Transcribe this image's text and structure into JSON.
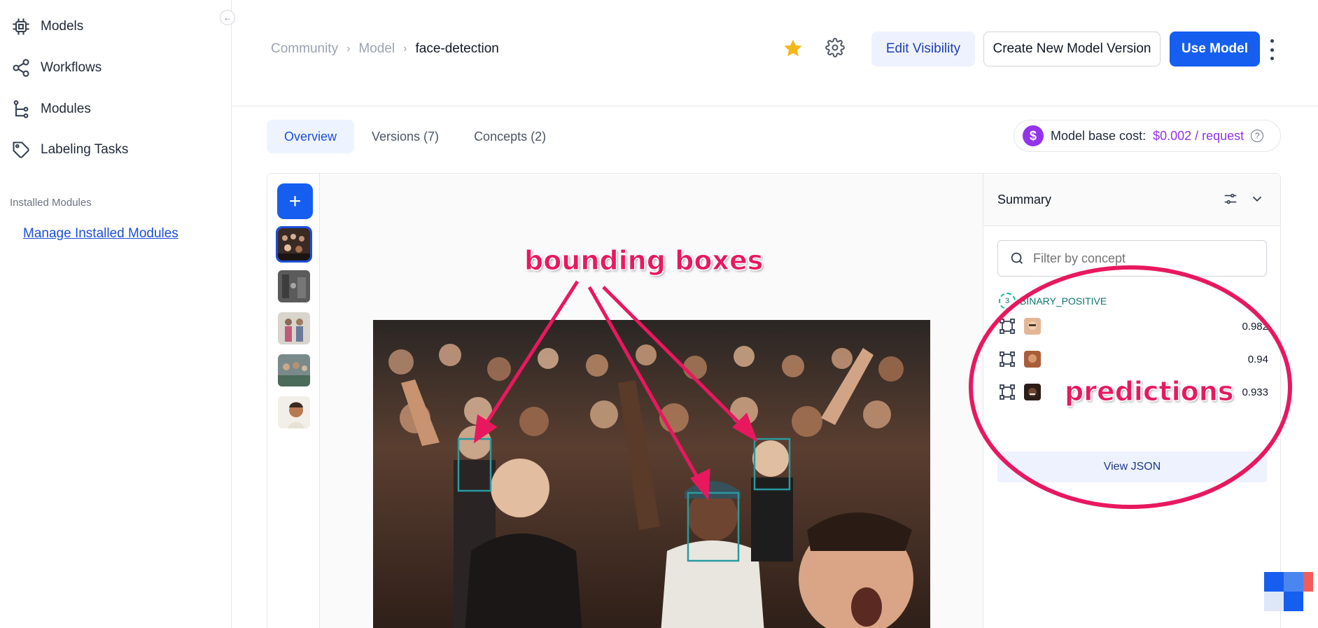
{
  "sidebar": {
    "collapse_icon": "chevron-left-icon",
    "items": [
      {
        "label": "Models",
        "icon": "chip-icon"
      },
      {
        "label": "Workflows",
        "icon": "share-nodes-icon"
      },
      {
        "label": "Modules",
        "icon": "tree-branch-icon"
      },
      {
        "label": "Labeling Tasks",
        "icon": "tag-icon"
      }
    ],
    "section_label": "Installed Modules",
    "manage_link": "Manage Installed Modules"
  },
  "header": {
    "breadcrumb": [
      "Community",
      "Model",
      "face-detection"
    ],
    "edit_visibility": "Edit Visibility",
    "create_version": "Create New Model Version",
    "use_model": "Use Model"
  },
  "tabs": [
    {
      "label": "Overview",
      "active": true
    },
    {
      "label": "Versions (7)",
      "active": false
    },
    {
      "label": "Concepts (2)",
      "active": false
    }
  ],
  "cost": {
    "label": "Model base cost:",
    "value": "$0.002 / request",
    "symbol": "$"
  },
  "gallery": {
    "add_symbol": "+",
    "thumbnail_count": 5,
    "selected_index": 0
  },
  "summary": {
    "title": "Summary",
    "filter_placeholder": "Filter by concept",
    "concept": {
      "name": "BINARY_POSITIVE",
      "count": "3"
    },
    "predictions": [
      {
        "score": "0.982"
      },
      {
        "score": "0.94"
      },
      {
        "score": "0.933"
      }
    ],
    "view_json": "View JSON"
  },
  "annotations": {
    "bounding_boxes": "bounding boxes",
    "predictions": "predictions"
  },
  "colors": {
    "primary": "#155eef",
    "annotation": "#e8185f",
    "cost": "#9333ea",
    "box": "#2a9aa0"
  }
}
